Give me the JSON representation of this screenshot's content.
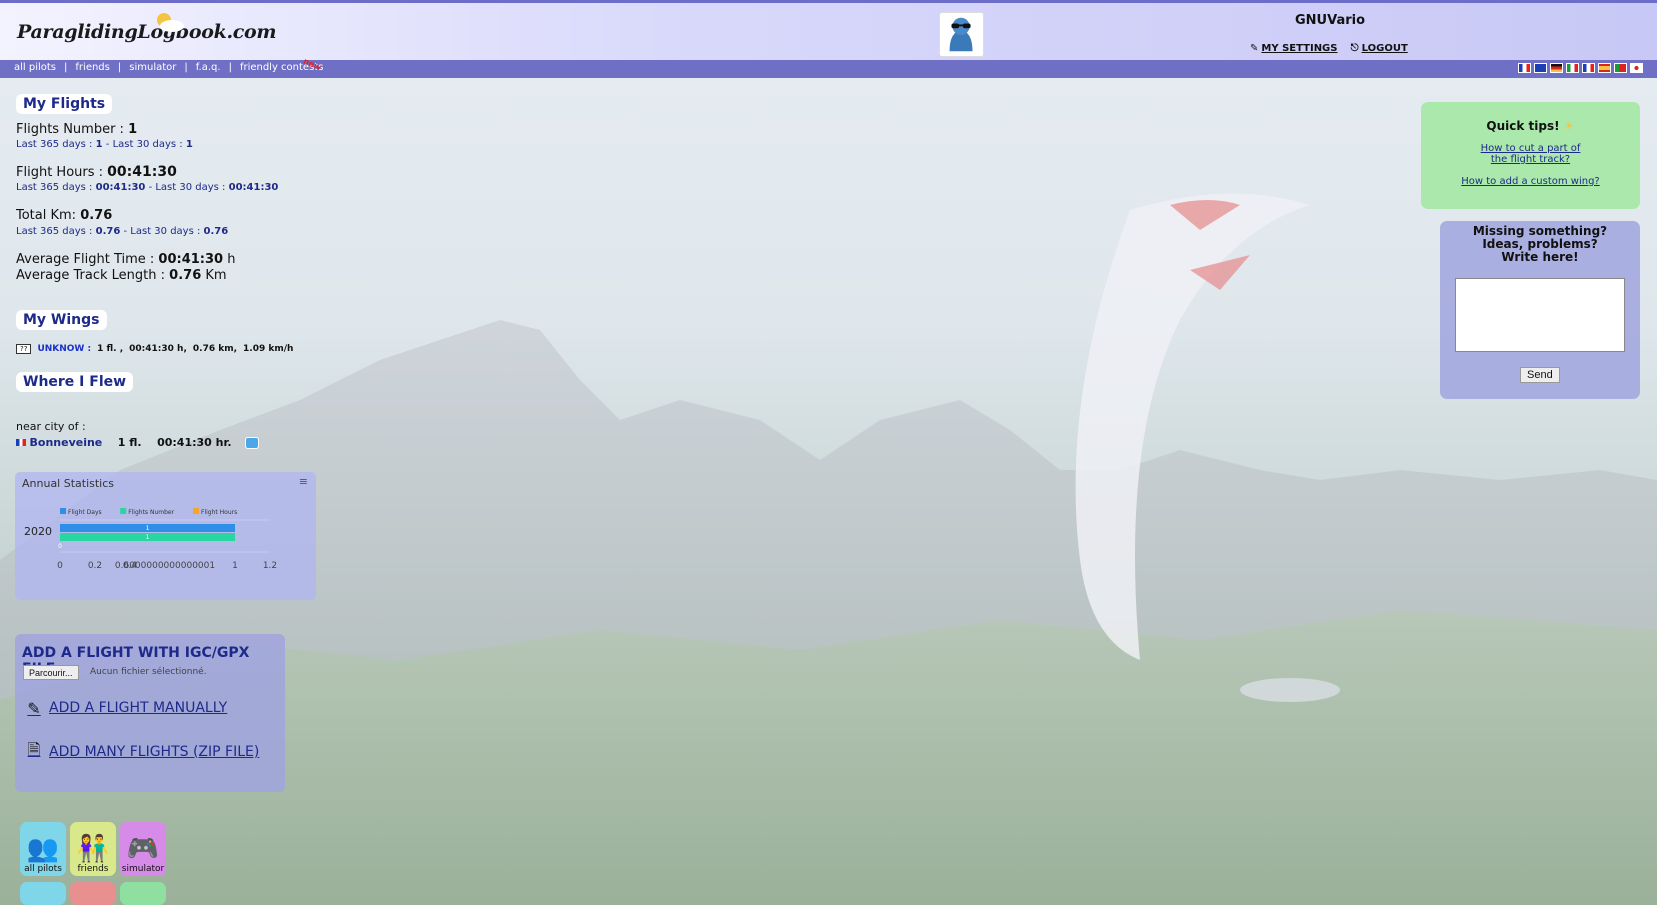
{
  "header": {
    "logo": "ParaglidingLogbook.com",
    "username": "GNUVario",
    "settings_label": "MY SETTINGS",
    "logout_label": "LOGOUT"
  },
  "nav": {
    "items": [
      "all pilots",
      "friends",
      "simulator",
      "f.a.q.",
      "friendly contests"
    ],
    "new_badge": "new"
  },
  "flags": [
    "fr",
    "gb",
    "de",
    "it",
    "fr2",
    "es",
    "pt",
    "jp"
  ],
  "my_flights": {
    "title": "My Flights",
    "flights_number_label": "Flights Number :",
    "flights_number": "1",
    "flights_sub_365_label": "Last 365 days :",
    "flights_sub_365": "1",
    "flights_sub_30_label": "- Last 30 days :",
    "flights_sub_30": "1",
    "hours_label": "Flight Hours :",
    "hours": "00:41:30",
    "hours_sub_365_label": "Last 365 days :",
    "hours_sub_365": "00:41:30",
    "hours_sub_30_label": "- Last 30 days :",
    "hours_sub_30": "00:41:30",
    "km_label": "Total Km:",
    "km": "0.76",
    "km_sub_365_label": "Last 365 days :",
    "km_sub_365": "0.76",
    "km_sub_30_label": "- Last 30 days :",
    "km_sub_30": "0.76",
    "avg_time_label": "Average Flight Time :",
    "avg_time": "00:41:30",
    "avg_time_unit": "h",
    "avg_track_label": "Average Track Length :",
    "avg_track": "0.76",
    "avg_track_unit": "Km"
  },
  "my_wings": {
    "title": "My Wings",
    "icon_text": "??",
    "name": "UNKNOW :",
    "flights": "1 fl. ,",
    "hours": "00:41:30 h,",
    "km": "0.76 km,",
    "speed": "1.09 km/h"
  },
  "where": {
    "title": "Where I Flew",
    "near_label": "near city of :",
    "city": "Bonneveine",
    "flights": "1 fl.",
    "hours": "00:41:30 hr."
  },
  "chart": {
    "title": "Annual Statistics",
    "menu": "≡"
  },
  "chart_data": {
    "type": "bar",
    "orientation": "horizontal",
    "categories": [
      "2020"
    ],
    "series": [
      {
        "name": "Flight Days",
        "values": [
          1
        ],
        "color": "#2f8fe8"
      },
      {
        "name": "Flights Number",
        "values": [
          1
        ],
        "color": "#27d6a0"
      },
      {
        "name": "Flight Hours",
        "values": [
          0
        ],
        "color": "#f5a623"
      }
    ],
    "data_labels": [
      "1",
      "1",
      "0"
    ],
    "x_ticks": [
      "0",
      "0.2",
      "0.4",
      "0.6000000000000001",
      "1",
      "1.2"
    ],
    "xlim": [
      0,
      1.2
    ],
    "legend": "top"
  },
  "add_flight": {
    "igc_title": "ADD A FLIGHT WITH IGC/GPX FILE",
    "browse_label": "Parcourir...",
    "no_file": "Aucun fichier sélectionné.",
    "manual_label": "ADD A FLIGHT MANUALLY",
    "zip_label": "ADD MANY FLIGHTS (ZIP FILE)"
  },
  "tiles": [
    {
      "label": "all pilots",
      "color": "#7fd6e8"
    },
    {
      "label": "friends",
      "color": "#d9e88a"
    },
    {
      "label": "simulator",
      "color": "#d78be8"
    }
  ],
  "tips": {
    "title": "Quick tips!",
    "tip1_line1": "How to cut a part of",
    "tip1_line2": "the flight track?",
    "tip2": "How to add a custom wing?"
  },
  "feedback": {
    "line1": "Missing something?",
    "line2": "Ideas, problems?",
    "line3": "Write here!",
    "send_label": "Send"
  }
}
